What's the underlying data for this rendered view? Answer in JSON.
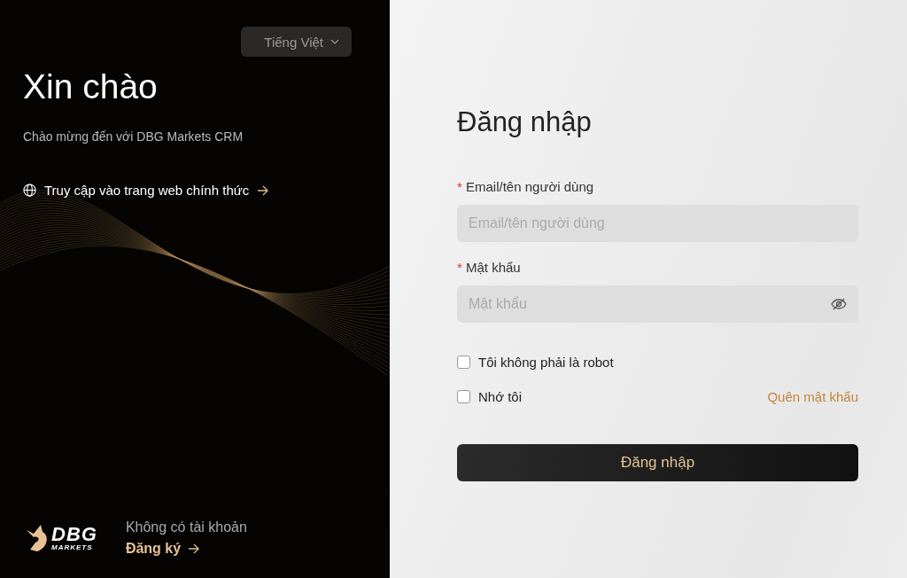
{
  "left": {
    "language": "Tiếng Việt",
    "greeting": "Xin chào",
    "welcome": "Chào mừng đến với DBG Markets CRM",
    "website_link": "Truy cập vào trang web chính thức",
    "logo": {
      "brand": "DBG",
      "sub": "MARKETS"
    },
    "no_account": "Không có tài khoản",
    "register_link": "Đăng ký"
  },
  "form": {
    "title": "Đăng nhập",
    "fields": [
      {
        "kind": "text",
        "required_mark": "*",
        "label": "Email/tên người dùng",
        "placeholder": "Email/tên người dùng"
      },
      {
        "kind": "password",
        "required_mark": "*",
        "label": "Mật khẩu",
        "placeholder": "Mật khẩu"
      }
    ],
    "checkboxes": [
      {
        "label": "Tôi không phải là robot",
        "checked": false
      },
      {
        "label": "Nhớ tôi",
        "checked": false
      }
    ],
    "forgot_link": "Quên mật khẩu",
    "submit": "Đăng nhập"
  }
}
